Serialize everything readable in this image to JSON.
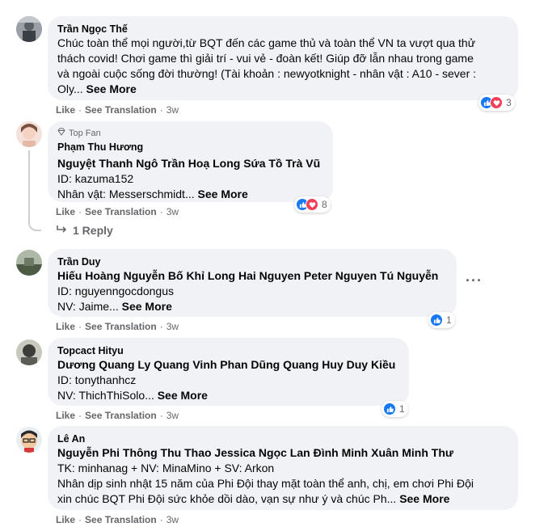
{
  "comments": [
    {
      "author": "Trần Ngọc Thế",
      "lines": [
        "Chúc toàn thể mọi người,từ BQT đến các game thủ và toàn thể VN ta vượt qua thử",
        "thách covid! Chơi game thì giải trí - vui vẻ - đoàn kết! Giúp đỡ lẫn nhau trong game",
        "và ngoài cuộc sống đời thường! (Tài khoản : newyotknight - nhân vật : A10 - sever :",
        "Oly..."
      ],
      "see_more": "See More",
      "like": "Like",
      "translate": "See Translation",
      "time": "3w",
      "reaction_count": "3"
    },
    {
      "badge": "Top Fan",
      "author": "Phạm Thu Hương",
      "lines": [
        "Nguyệt Thanh Ngô Trần Hoạ Long Sứa Tồ Trà Vũ",
        "ID: kazuma152",
        "Nhân vật: Messerschmidt..."
      ],
      "see_more": "See More",
      "like": "Like",
      "translate": "See Translation",
      "time": "3w",
      "reaction_count": "8",
      "replies_label": "1 Reply"
    },
    {
      "author": "Trần Duy",
      "lines": [
        "Hiếu Hoàng Nguyễn Bố Khỉ Long Hai Nguyen Peter Nguyen Tú Nguyễn",
        "ID: nguyenngocdongus",
        "NV: Jaime..."
      ],
      "see_more": "See More",
      "like": "Like",
      "translate": "See Translation",
      "time": "3w",
      "reaction_count": "1",
      "more_label": "···"
    },
    {
      "author": "Topcact Hityu",
      "lines": [
        "Dương Quang Ly Quang Vinh Phan Dũng Quang Huy Duy Kiều",
        "ID: tonythanhcz",
        "NV: ThichThiSolo..."
      ],
      "see_more": "See More",
      "like": "Like",
      "translate": "See Translation",
      "time": "3w",
      "reaction_count": "1"
    },
    {
      "author": "Lê An",
      "lines": [
        "Nguyễn Phi Thông Thu Thao Jessica Ngọc Lan Đình Minh Xuân Minh Thư",
        "TK: minhanag + NV: MinaMino + SV: Arkon",
        "Nhân dịp sinh nhật 15 năm của Phi Đội thay mặt toàn thể anh, chị, em chơi Phi Đội",
        "xin chúc BQT Phi Đội sức khỏe dồi dào, vạn sự như ý và chúc Ph..."
      ],
      "see_more": "See More",
      "like": "Like",
      "translate": "See Translation",
      "time": "3w"
    }
  ],
  "colors": {
    "bubble": "#f0f2f5",
    "like": "#1877f2",
    "love": "#f33e58",
    "meta": "#65676b"
  },
  "icons": {
    "like": "thumbs-up-icon",
    "love": "heart-icon",
    "badge": "diamond-icon",
    "reply": "reply-arrow-icon",
    "more": "more-dots-icon"
  }
}
